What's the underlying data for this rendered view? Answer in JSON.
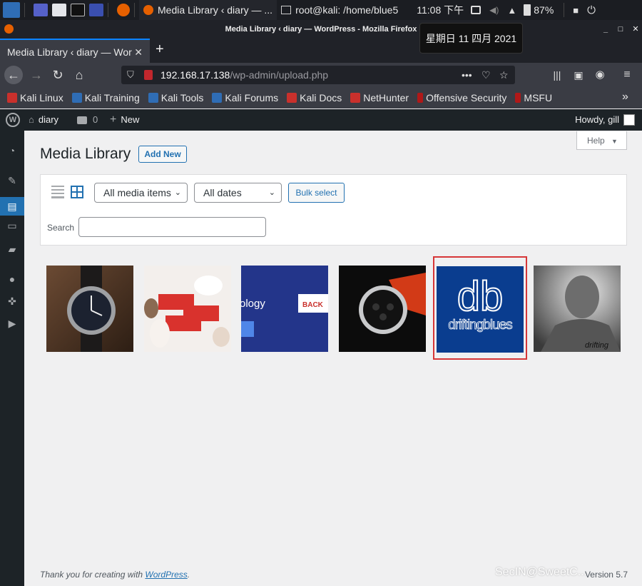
{
  "taskbar": {
    "firefox_task": "Media Library ‹ diary — ...",
    "terminal_task": "root@kali: /home/blue5",
    "clock": "11:08 下午",
    "battery": "87%"
  },
  "window": {
    "title": "Media Library ‹ diary — WordPress - Mozilla Firefox"
  },
  "tooltip": {
    "date": "星期日 11 四月 2021"
  },
  "tab": {
    "label": "Media Library ‹ diary — Wor"
  },
  "url": {
    "host": "192.168.17.138",
    "path": "/wp-admin/upload.php"
  },
  "bookmarks": [
    "Kali Linux",
    "Kali Training",
    "Kali Tools",
    "Kali Forums",
    "Kali Docs",
    "NetHunter",
    "Offensive Security",
    "MSFU"
  ],
  "adminbar": {
    "site": "diary",
    "comments": "0",
    "new": "New",
    "howdy": "Howdy, gill"
  },
  "page": {
    "title": "Media Library",
    "add_new": "Add New",
    "help": "Help"
  },
  "filters": {
    "media_type": "All media items",
    "dates": "All dates",
    "bulk_select": "Bulk select",
    "search_label": "Search",
    "search_value": ""
  },
  "media": [
    {
      "name": "watch-black-leather"
    },
    {
      "name": "cats-red-blocks"
    },
    {
      "name": "technology-banner"
    },
    {
      "name": "omega-speedmaster"
    },
    {
      "name": "driftingblues-logo",
      "logo_top": "db",
      "logo_bottom": "driftingblues",
      "selected": true
    },
    {
      "name": "gigachad-portrait",
      "caption": "drifting"
    }
  ],
  "footer": {
    "thanks": "Thank you for creating with ",
    "wp_link": "WordPress",
    "period": ".",
    "version": "Version 5.7",
    "watermark": "SecIN@SweetC..."
  },
  "colors": {
    "accent": "#2271b1",
    "admin_bg": "#1d2327",
    "selected_border": "#d63638",
    "db_logo_bg": "#0a3d8f"
  }
}
